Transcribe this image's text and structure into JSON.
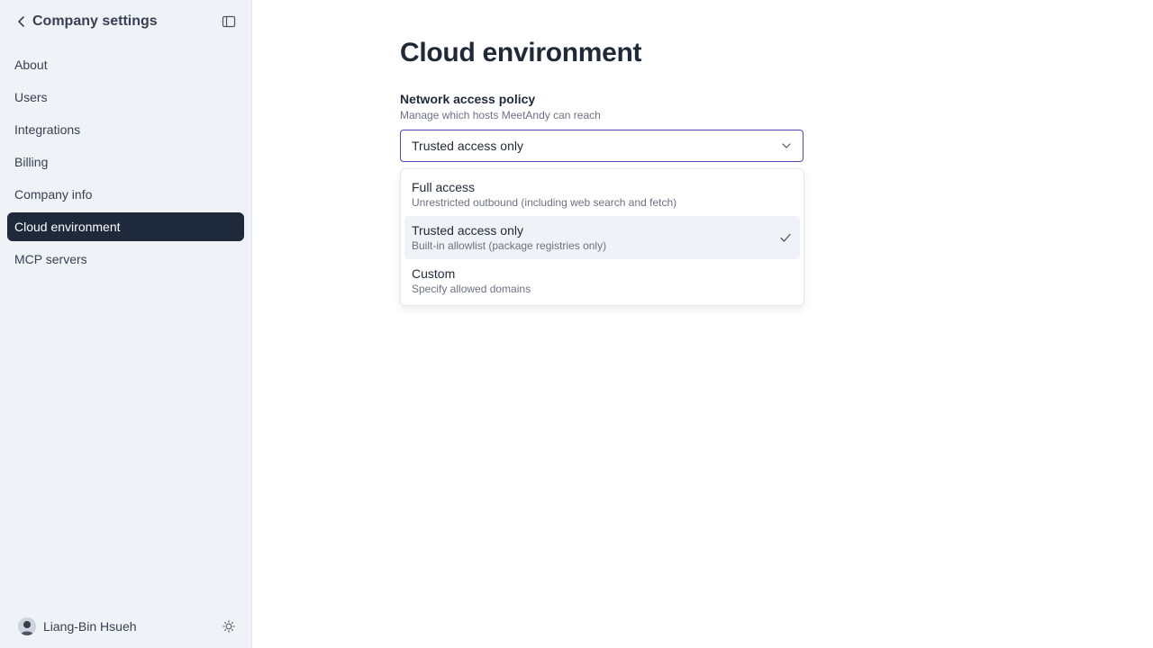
{
  "sidebar": {
    "title": "Company settings",
    "items": [
      {
        "label": "About"
      },
      {
        "label": "Users"
      },
      {
        "label": "Integrations"
      },
      {
        "label": "Billing"
      },
      {
        "label": "Company info"
      },
      {
        "label": "Cloud environment",
        "active": true
      },
      {
        "label": "MCP servers"
      }
    ],
    "user": {
      "name": "Liang-Bin Hsueh"
    }
  },
  "main": {
    "title": "Cloud environment",
    "network_policy": {
      "label": "Network access policy",
      "hint": "Manage which hosts MeetAndy can reach",
      "selected": "Trusted access only",
      "options": [
        {
          "label": "Full access",
          "description": "Unrestricted outbound (including web search and fetch)"
        },
        {
          "label": "Trusted access only",
          "description": "Built-in allowlist (package registries only)",
          "selected": true
        },
        {
          "label": "Custom",
          "description": "Specify allowed domains"
        }
      ]
    }
  },
  "icons": [
    "chevron-left-icon",
    "sidebar-toggle-icon",
    "chevron-down-icon",
    "check-icon",
    "sun-icon"
  ],
  "colors": {
    "active_bg": "#1e293b",
    "sidebar_bg": "#eff2f7",
    "focus_border": "#4f46b8"
  }
}
